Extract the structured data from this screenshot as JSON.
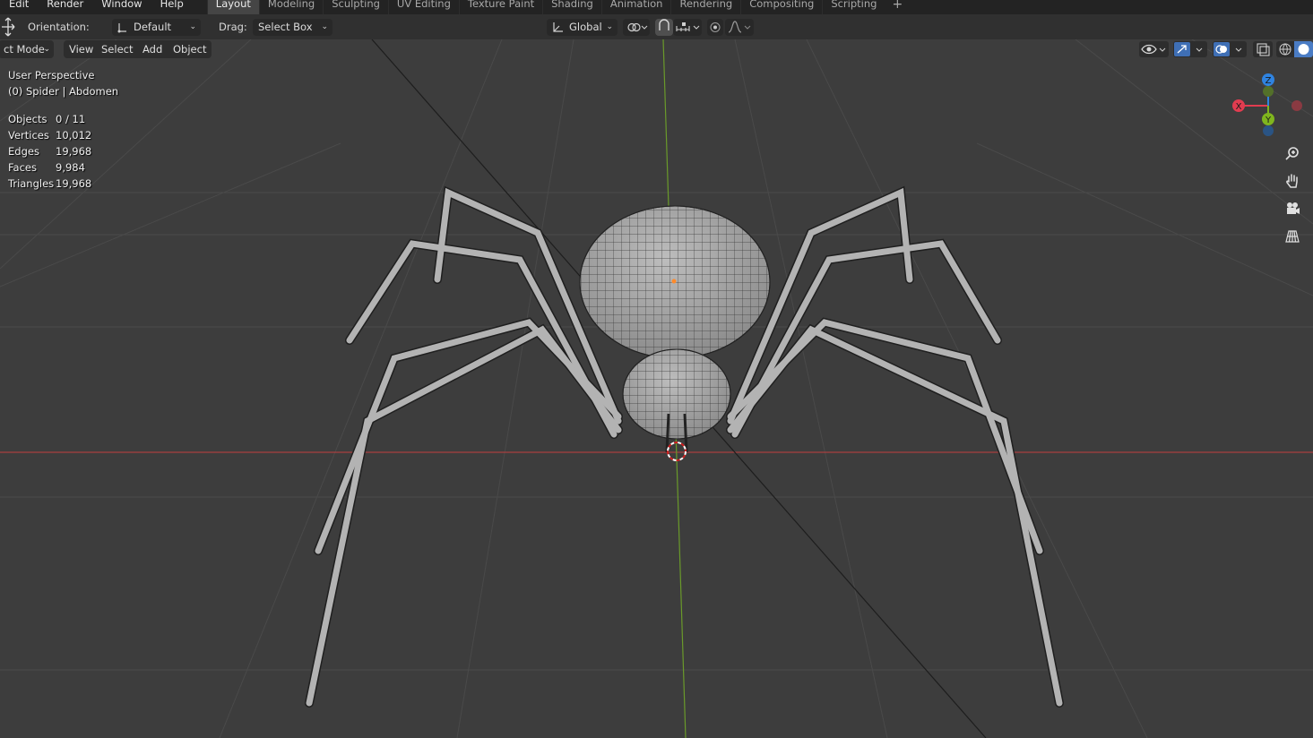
{
  "menu": [
    "Edit",
    "Render",
    "Window",
    "Help"
  ],
  "workspaces": [
    {
      "label": "Layout",
      "active": true
    },
    {
      "label": "Modeling",
      "active": false
    },
    {
      "label": "Sculpting",
      "active": false
    },
    {
      "label": "UV Editing",
      "active": false
    },
    {
      "label": "Texture Paint",
      "active": false
    },
    {
      "label": "Shading",
      "active": false
    },
    {
      "label": "Animation",
      "active": false
    },
    {
      "label": "Rendering",
      "active": false
    },
    {
      "label": "Compositing",
      "active": false
    },
    {
      "label": "Scripting",
      "active": false
    }
  ],
  "add_workspace": "+",
  "toolbar": {
    "orientation_label": "Orientation:",
    "orientation_value": "Default",
    "drag_label": "Drag:",
    "drag_value": "Select Box",
    "transform_space": "Global"
  },
  "viewport_header": {
    "mode": "ct Mode",
    "menus": [
      "View",
      "Select",
      "Add",
      "Object"
    ]
  },
  "overlay": {
    "perspective": "User Perspective",
    "context": "(0) Spider | Abdomen",
    "stats": [
      {
        "label": "Objects",
        "value": "0 / 11"
      },
      {
        "label": "Vertices",
        "value": "10,012"
      },
      {
        "label": "Edges",
        "value": "19,968"
      },
      {
        "label": "Faces",
        "value": "9,984"
      },
      {
        "label": "Triangles",
        "value": "19,968"
      }
    ]
  },
  "gizmo": {
    "x_label": "X",
    "y_label": "Y",
    "z_label": "Z",
    "x_color": "#e23c50",
    "y_color": "#7fb51e",
    "z_color": "#2f83e0"
  },
  "navigation_icons": [
    "zoom-icon",
    "hand-pan-icon",
    "camera-icon",
    "grid-ortho-icon"
  ],
  "colors": {
    "background": "#3d3d3d",
    "x_axis": "#b53a3a",
    "y_axis": "#6a9a2a",
    "active_tab": "#454545"
  }
}
